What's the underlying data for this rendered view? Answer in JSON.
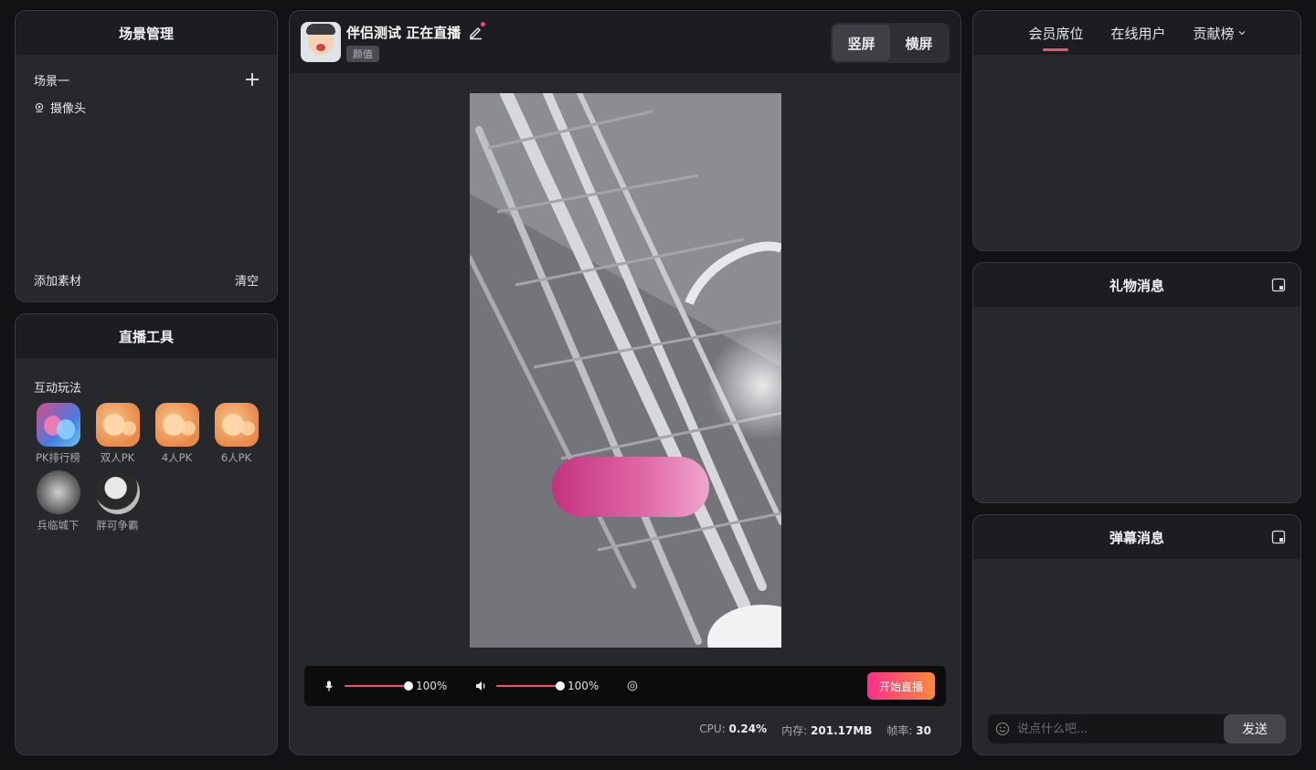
{
  "scene_panel": {
    "title": "场景管理",
    "scene_name": "场景一",
    "sources": [
      {
        "label": "摄像头",
        "icon": "location-pin-icon"
      }
    ],
    "add_material": "添加素材",
    "clear": "清空"
  },
  "tools_panel": {
    "title": "直播工具",
    "section": "互动玩法",
    "games": [
      {
        "name": "PK排行榜"
      },
      {
        "name": "双人PK"
      },
      {
        "name": "4人PK"
      },
      {
        "name": "6人PK"
      },
      {
        "name": "兵临城下"
      },
      {
        "name": "胖可争霸"
      }
    ]
  },
  "stream": {
    "room_title": "伴侣测试 正在直播",
    "category_tag": "颜值",
    "orientation": {
      "portrait": "竖屏",
      "landscape": "横屏",
      "selected": "portrait"
    }
  },
  "controls": {
    "mic_volume": "100%",
    "mic_level": 1.0,
    "speaker_volume": "100%",
    "speaker_level": 1.0,
    "start_button": "开始直播"
  },
  "stats": {
    "cpu_label": "CPU:",
    "cpu_value": "0.24%",
    "mem_label": "内存:",
    "mem_value": "201.17MB",
    "fps_label": "帧率:",
    "fps_value": "30"
  },
  "members_panel": {
    "tabs": [
      {
        "label": "会员席位"
      },
      {
        "label": "在线用户"
      },
      {
        "label": "贡献榜"
      }
    ],
    "active_tab": 0
  },
  "gift_panel": {
    "title": "礼物消息"
  },
  "danmu_panel": {
    "title": "弹幕消息",
    "input_placeholder": "说点什么吧...",
    "send": "发送"
  },
  "colors": {
    "accent": "#ff4a78",
    "start_gradient_from": "#ff2e8a",
    "start_gradient_to": "#ff8a3a",
    "panel_bg": "#27282b",
    "header_bg": "#1c1d20"
  }
}
